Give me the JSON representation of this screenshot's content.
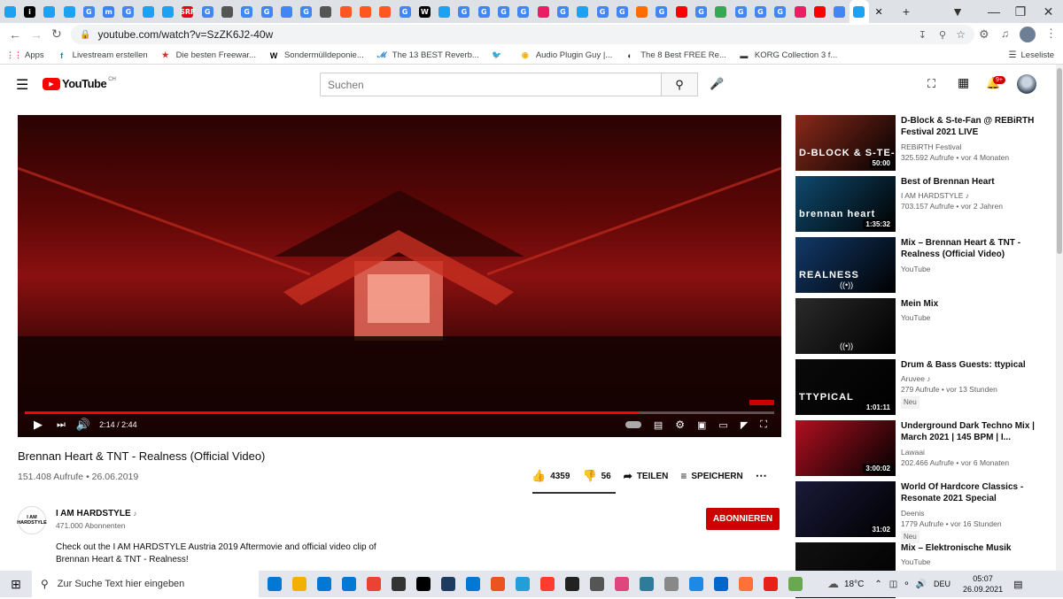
{
  "tabs": [
    {
      "c": "#1da1f2",
      "g": ""
    },
    {
      "c": "#000",
      "g": "i"
    },
    {
      "c": "#1da1f2",
      "g": ""
    },
    {
      "c": "#1da1f2",
      "g": ""
    },
    {
      "c": "#4285f4",
      "g": "G"
    },
    {
      "c": "#3b82f6",
      "g": "m"
    },
    {
      "c": "#4285f4",
      "g": "G"
    },
    {
      "c": "#1da1f2",
      "g": ""
    },
    {
      "c": "#1da1f2",
      "g": ""
    },
    {
      "c": "#e30613",
      "g": "SRF"
    },
    {
      "c": "#4285f4",
      "g": "G"
    },
    {
      "c": "#555",
      "g": ""
    },
    {
      "c": "#4285f4",
      "g": "G"
    },
    {
      "c": "#4285f4",
      "g": "G"
    },
    {
      "c": "#4285f4",
      "g": ""
    },
    {
      "c": "#4285f4",
      "g": "G"
    },
    {
      "c": "#555",
      "g": ""
    },
    {
      "c": "#ff5722",
      "g": ""
    },
    {
      "c": "#ff5722",
      "g": ""
    },
    {
      "c": "#ff5722",
      "g": ""
    },
    {
      "c": "#4285f4",
      "g": "G"
    },
    {
      "c": "#000",
      "g": "W"
    },
    {
      "c": "#1da1f2",
      "g": ""
    },
    {
      "c": "#4285f4",
      "g": "G"
    },
    {
      "c": "#4285f4",
      "g": "G"
    },
    {
      "c": "#4285f4",
      "g": "G"
    },
    {
      "c": "#4285f4",
      "g": "G"
    },
    {
      "c": "#e91e63",
      "g": ""
    },
    {
      "c": "#4285f4",
      "g": "G"
    },
    {
      "c": "#1da1f2",
      "g": ""
    },
    {
      "c": "#4285f4",
      "g": "G"
    },
    {
      "c": "#4285f4",
      "g": "G"
    },
    {
      "c": "#ff6d00",
      "g": ""
    },
    {
      "c": "#4285f4",
      "g": "G"
    },
    {
      "c": "#ff0000",
      "g": ""
    },
    {
      "c": "#4285f4",
      "g": "G"
    },
    {
      "c": "#34a853",
      "g": ""
    },
    {
      "c": "#4285f4",
      "g": "G"
    },
    {
      "c": "#4285f4",
      "g": "G"
    },
    {
      "c": "#4285f4",
      "g": "G"
    },
    {
      "c": "#e91e63",
      "g": ""
    },
    {
      "c": "#ff0000",
      "g": ""
    },
    {
      "c": "#4285f4",
      "g": ""
    },
    {
      "c": "#1da1f2",
      "g": ""
    }
  ],
  "browser": {
    "url": "youtube.com/watch?v=SzZK6J2-40w",
    "reading_list": "Leseliste"
  },
  "bookmarks": [
    "Apps",
    "Livestream erstellen",
    "Die besten Freewar...",
    "Sondermülldeponie...",
    "The 13 BEST Reverb...",
    "",
    "Audio Plugin Guy |...",
    "The 8 Best FREE Re...",
    "KORG Collection 3 f..."
  ],
  "yt": {
    "logo": "YouTube",
    "region": "CH",
    "search_placeholder": "Suchen",
    "notif": "9+"
  },
  "video": {
    "title": "Brennan Heart & TNT - Realness (Official Video)",
    "time": "2:14 / 2:44",
    "progress": 0.82,
    "views": "151.408 Aufrufe • 26.06.2019",
    "likes": "4359",
    "dislikes": "56",
    "share": "TEILEN",
    "save": "SPEICHERN"
  },
  "channel": {
    "name": "I AM HARDSTYLE",
    "subs": "471.000 Abonnenten",
    "subscribe": "ABONNIEREN",
    "avatar": "I AM HARDSTYLE"
  },
  "description": "Check out the I AM HARDSTYLE Austria 2019 Aftermovie and official video clip of Brennan Heart & TNT - Realness!",
  "sidebar": [
    {
      "title": "D-Block & S-te-Fan @ REBiRTH Festival 2021 LIVE",
      "channel": "REBiRTH Festival",
      "stats": "325.592 Aufrufe • vor 4 Monaten",
      "duration": "50:00",
      "thumb_text": "D-BLOCK & S-TE-FA",
      "bg": "#8a2a1a"
    },
    {
      "title": "Best of Brennan Heart",
      "channel": "I AM HARDSTYLE ♪",
      "stats": "703.157 Aufrufe • vor 2 Jahren",
      "duration": "1:35:32",
      "thumb_text": "brennan heart",
      "bg": "#0f4a6e"
    },
    {
      "title": "Mix – Brennan Heart & TNT - Realness (Official Video)",
      "channel": "YouTube",
      "stats": "",
      "duration": "",
      "thumb_text": "REALNESS",
      "bg": "#123a6a"
    },
    {
      "title": "Mein Mix",
      "channel": "YouTube",
      "stats": "",
      "duration": "",
      "thumb_text": "",
      "bg": "#2a2a2a"
    },
    {
      "title": "Drum & Bass Guests: ttypical",
      "channel": "Aruvee ♪",
      "stats": "279 Aufrufe • vor 13 Stunden",
      "duration": "1:01:11",
      "thumb_text": "TTYPICAL",
      "bg": "#0a0a0a",
      "badge": "Neu"
    },
    {
      "title": "Underground Dark Techno Mix | March 2021 | 145 BPM | I...",
      "channel": "Lawaai",
      "stats": "202.466 Aufrufe • vor 6 Monaten",
      "duration": "3:00:02",
      "thumb_text": "",
      "bg": "#b01020"
    },
    {
      "title": "World Of Hardcore Classics - Resonate 2021 Special",
      "channel": "Deenis",
      "stats": "1779 Aufrufe • vor 16 Stunden",
      "duration": "31:02",
      "thumb_text": "",
      "bg": "#1a1a3a",
      "badge": "Neu"
    },
    {
      "title": "Mix – Elektronische Musik",
      "channel": "YouTube",
      "stats": "",
      "duration": "",
      "thumb_text": "",
      "bg": "#111"
    }
  ],
  "taskbar": {
    "search": "Zur Suche Text hier eingeben",
    "weather": "18°C",
    "lang": "DEU",
    "time": "05:07",
    "date": "26.09.2021",
    "apps": [
      "#0078d4",
      "#f2b000",
      "#0078d4",
      "#0078d4",
      "#ea4335",
      "#333",
      "#000",
      "#1e3a5f",
      "#0078d4",
      "#e95420",
      "#229ed9",
      "#ff3b30",
      "#222",
      "#555",
      "#e0457b",
      "#2d7d9a",
      "#888",
      "#1e88e5",
      "#0066cc",
      "#ff7139",
      "#e62117",
      "#6aa84f"
    ]
  }
}
